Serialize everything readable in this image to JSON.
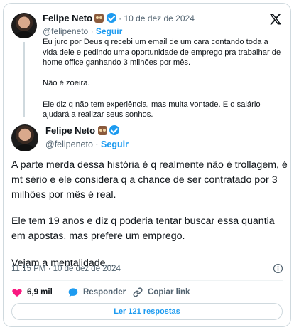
{
  "quoted_tweet": {
    "author_name": "Felipe Neto",
    "handle": "@felipeneto",
    "separator": "·",
    "date": "10 de dez de 2024",
    "follow_label": "Seguir",
    "paragraphs": [
      "Eu juro por Deus q recebi um email de um cara contando toda a vida dele e pedindo uma oportunidade de emprego pra trabalhar de home office ganhando 3 milhões por mês.",
      "Não é zoeira.",
      "Ele diz q não tem experiência, mas muita vontade. E o salário ajudará a realizar seus sonhos."
    ]
  },
  "main_tweet": {
    "author_name": "Felipe Neto",
    "handle": "@felipeneto",
    "separator": "·",
    "follow_label": "Seguir",
    "paragraphs": [
      "A parte merda dessa história é q realmente não é trollagem, é mt sério e ele considera q a chance de ser contratado por 3 milhões por mês é real.",
      "Ele tem 19 anos e diz q poderia tentar buscar essa quantia em apostas, mas prefere um emprego.",
      "Vejam a mentalidade..."
    ],
    "timestamp": "11:15 PM · 10 de dez de 2024"
  },
  "actions": {
    "likes": "6,9 mil",
    "reply_label": "Responder",
    "copy_label": "Copiar link"
  },
  "replies_button_label": "Ler 121 respostas",
  "icons": {
    "logo": "x-logo-icon",
    "badge": "owl-emoji-icon",
    "verified": "verified-badge-icon",
    "info": "info-icon",
    "like": "heart-icon",
    "reply": "speech-bubble-icon",
    "copy": "link-icon"
  },
  "colors": {
    "accent": "#1d9bf0",
    "like": "#f91880",
    "text": "#0f1419",
    "muted": "#536471",
    "border": "#cfd9de"
  }
}
